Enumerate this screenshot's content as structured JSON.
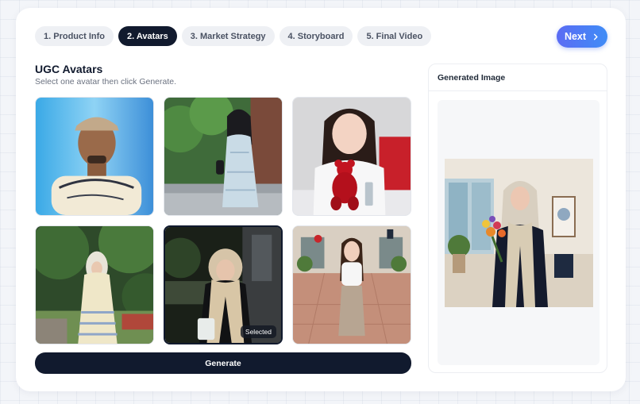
{
  "steps": [
    {
      "label": "1. Product Info",
      "active": false
    },
    {
      "label": "2. Avatars",
      "active": true
    },
    {
      "label": "3. Market Strategy",
      "active": false
    },
    {
      "label": "4. Storyboard",
      "active": false
    },
    {
      "label": "5. Final Video",
      "active": false
    }
  ],
  "next_label": "Next",
  "section": {
    "title": "UGC Avatars",
    "subtitle": "Select one avatar then click Generate."
  },
  "avatars": [
    {
      "icon": "avatar-photo-man-cap",
      "selected": false
    },
    {
      "icon": "avatar-photo-woman-floral-dress",
      "selected": false
    },
    {
      "icon": "avatar-photo-woman-red-bear",
      "selected": false
    },
    {
      "icon": "avatar-photo-woman-hijab-park",
      "selected": false
    },
    {
      "icon": "avatar-photo-woman-hijab-night",
      "selected": true
    },
    {
      "icon": "avatar-photo-woman-street",
      "selected": false
    }
  ],
  "selected_badge": "Selected",
  "generate_label": "Generate",
  "panel": {
    "title": "Generated Image"
  },
  "colors": {
    "accent_dark": "#111a2e",
    "next_gradient_start": "#5b6cf4",
    "next_gradient_end": "#3f8cf6"
  }
}
